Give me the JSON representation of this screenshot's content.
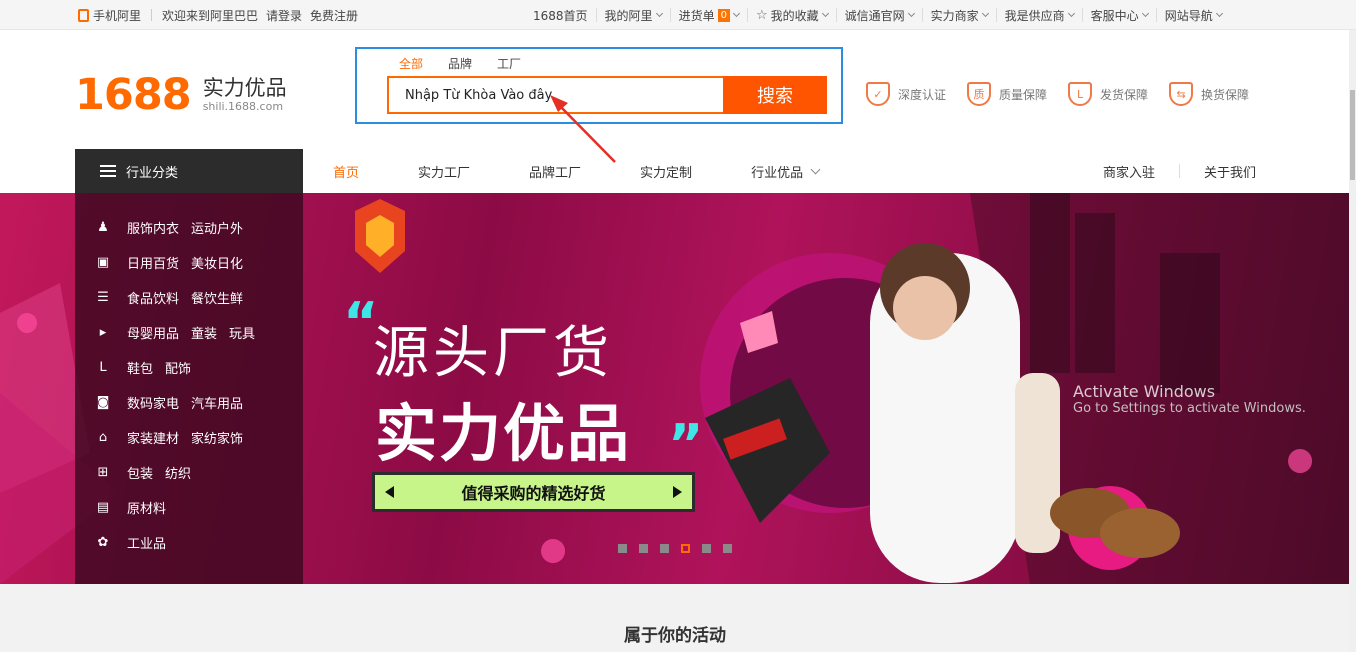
{
  "topbar": {
    "mobile": "手机阿里",
    "welcome": "欢迎来到阿里巴巴",
    "login": "请登录",
    "register": "免费注册",
    "items": [
      "1688首页",
      "我的阿里",
      "进货单",
      "我的收藏",
      "诚信通官网",
      "实力商家",
      "我是供应商",
      "客服中心",
      "网站导航"
    ],
    "cart_count": "0"
  },
  "logo": {
    "number": "1688",
    "title": "实力优品",
    "domain": "shili.1688.com"
  },
  "search": {
    "tabs": [
      "全部",
      "品牌",
      "工厂"
    ],
    "value": "Nhập Từ Khòa Vào đây",
    "button": "搜索"
  },
  "guarantees": [
    "深度认证",
    "质量保障",
    "发货保障",
    "换货保障"
  ],
  "nav": {
    "category_head": "行业分类",
    "links": [
      "首页",
      "实力工厂",
      "品牌工厂",
      "实力定制",
      "行业优品"
    ],
    "right": [
      "商家入驻",
      "关于我们"
    ]
  },
  "categories": [
    {
      "icon": "shirt-icon",
      "items": [
        "服饰内衣",
        "运动户外"
      ]
    },
    {
      "icon": "bag-icon",
      "items": [
        "日用百货",
        "美妆日化"
      ]
    },
    {
      "icon": "bowl-icon",
      "items": [
        "食品饮料",
        "餐饮生鲜"
      ]
    },
    {
      "icon": "play-icon",
      "items": [
        "母婴用品",
        "童装",
        "玩具"
      ]
    },
    {
      "icon": "shoe-icon",
      "items": [
        "鞋包",
        "配饰"
      ]
    },
    {
      "icon": "camera-icon",
      "items": [
        "数码家电",
        "汽车用品"
      ]
    },
    {
      "icon": "home-icon",
      "items": [
        "家装建材",
        "家纺家饰"
      ]
    },
    {
      "icon": "gift-icon",
      "items": [
        "包装",
        "纺织"
      ]
    },
    {
      "icon": "material-icon",
      "items": [
        "原材料"
      ]
    },
    {
      "icon": "industry-icon",
      "items": [
        "工业品"
      ]
    }
  ],
  "banner": {
    "headline1": "源头厂货",
    "headline2": "实力优品",
    "cta": "值得采购的精选好货",
    "dots_count": 6,
    "active_dot": 4
  },
  "watermark": {
    "line1": "Activate Windows",
    "line2": "Go to Settings to activate Windows."
  },
  "section_title": "属于你的活动",
  "colors": {
    "brand": "#ff6a00",
    "search_border": "#2b8ce0",
    "banner": "#a3104f",
    "cta_bg": "#c8f58a"
  }
}
